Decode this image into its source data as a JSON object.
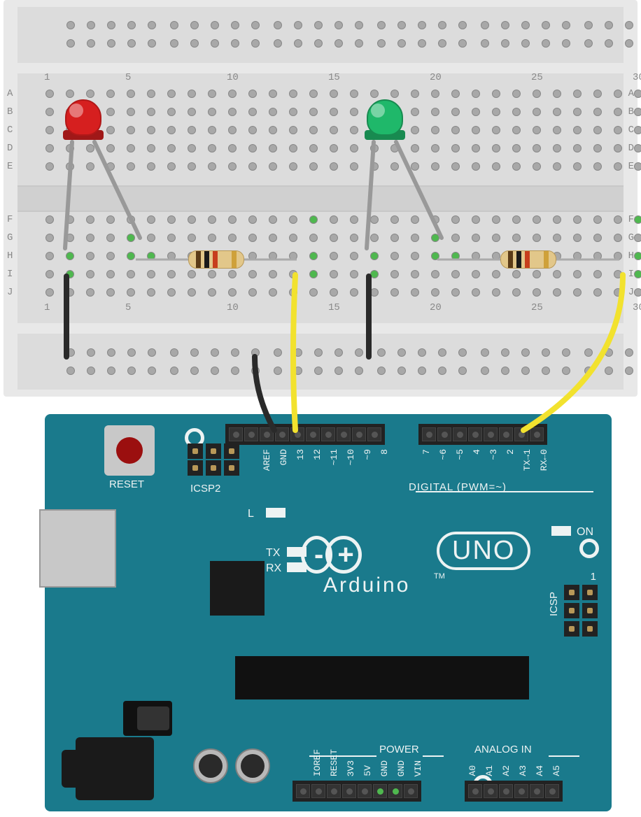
{
  "breadboard": {
    "cols": [
      1,
      5,
      10,
      15,
      20,
      25,
      30
    ],
    "rows": [
      "A",
      "B",
      "C",
      "D",
      "E",
      "F",
      "G",
      "H",
      "I",
      "J"
    ]
  },
  "leds": [
    {
      "name": "red-led",
      "color": "red",
      "fill": "#d61f1f",
      "base": "#a01818"
    },
    {
      "name": "green-led",
      "color": "green",
      "fill": "#1fb86a",
      "base": "#188a50"
    }
  ],
  "resistors": [
    {
      "name": "resistor-1",
      "bands": [
        "#5a3b17",
        "#1a1a1a",
        "#c73e1d",
        "#cfa13a"
      ]
    },
    {
      "name": "resistor-2",
      "bands": [
        "#5a3b17",
        "#1a1a1a",
        "#c73e1d",
        "#cfa13a"
      ]
    }
  ],
  "arduino": {
    "reset": "RESET",
    "icsp2": "ICSP2",
    "icsp": "ICSP",
    "brand": "Arduino",
    "model": "UNO",
    "tm": "TM",
    "digital_label": "DIGITAL (PWM=~)",
    "power_label": "POWER",
    "analog_label": "ANALOG IN",
    "leds": {
      "L": "L",
      "TX": "TX",
      "RX": "RX",
      "ON": "ON"
    },
    "top_row1": [
      "AREF",
      "GND",
      "13",
      "12",
      "~11",
      "~10",
      "~9",
      "8"
    ],
    "top_row2": [
      "7",
      "~6",
      "~5",
      "4",
      "~3",
      "2",
      "TX→1",
      "RX←0"
    ],
    "power_row": [
      "IOREF",
      "RESET",
      "3V3",
      "5V",
      "GND",
      "GND",
      "VIN"
    ],
    "analog_row": [
      "A0",
      "A1",
      "A2",
      "A3",
      "A4",
      "A5"
    ],
    "icsp_num": "1"
  }
}
